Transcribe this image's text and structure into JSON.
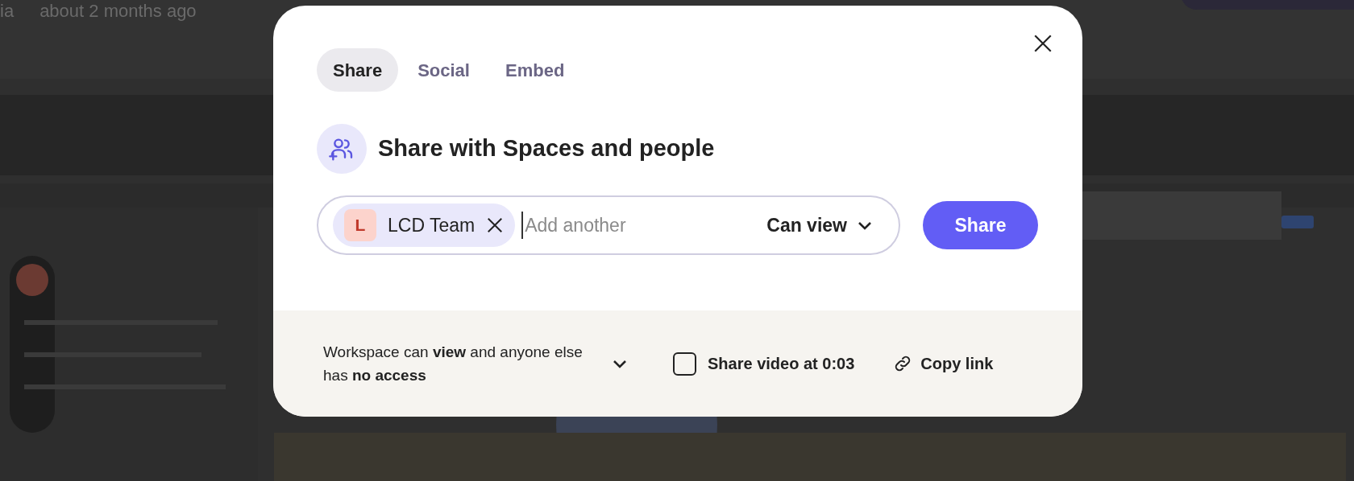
{
  "background": {
    "author": "ia",
    "time": "about 2 months ago"
  },
  "modal": {
    "tabs": [
      {
        "label": "Share",
        "selected": true
      },
      {
        "label": "Social",
        "selected": false
      },
      {
        "label": "Embed",
        "selected": false
      }
    ],
    "heading": "Share with Spaces and people",
    "recipients": [
      {
        "initial": "L",
        "name": "LCD Team",
        "color": "#fcd3cc"
      }
    ],
    "input": {
      "placeholder": "Add another"
    },
    "permission": "Can view",
    "share_button": "Share",
    "access": "Workspace can **view** and anyone else has **no access**",
    "share_at_time": {
      "label": "Share video at 0:03",
      "checked": false
    },
    "copy_link": "Copy link"
  }
}
